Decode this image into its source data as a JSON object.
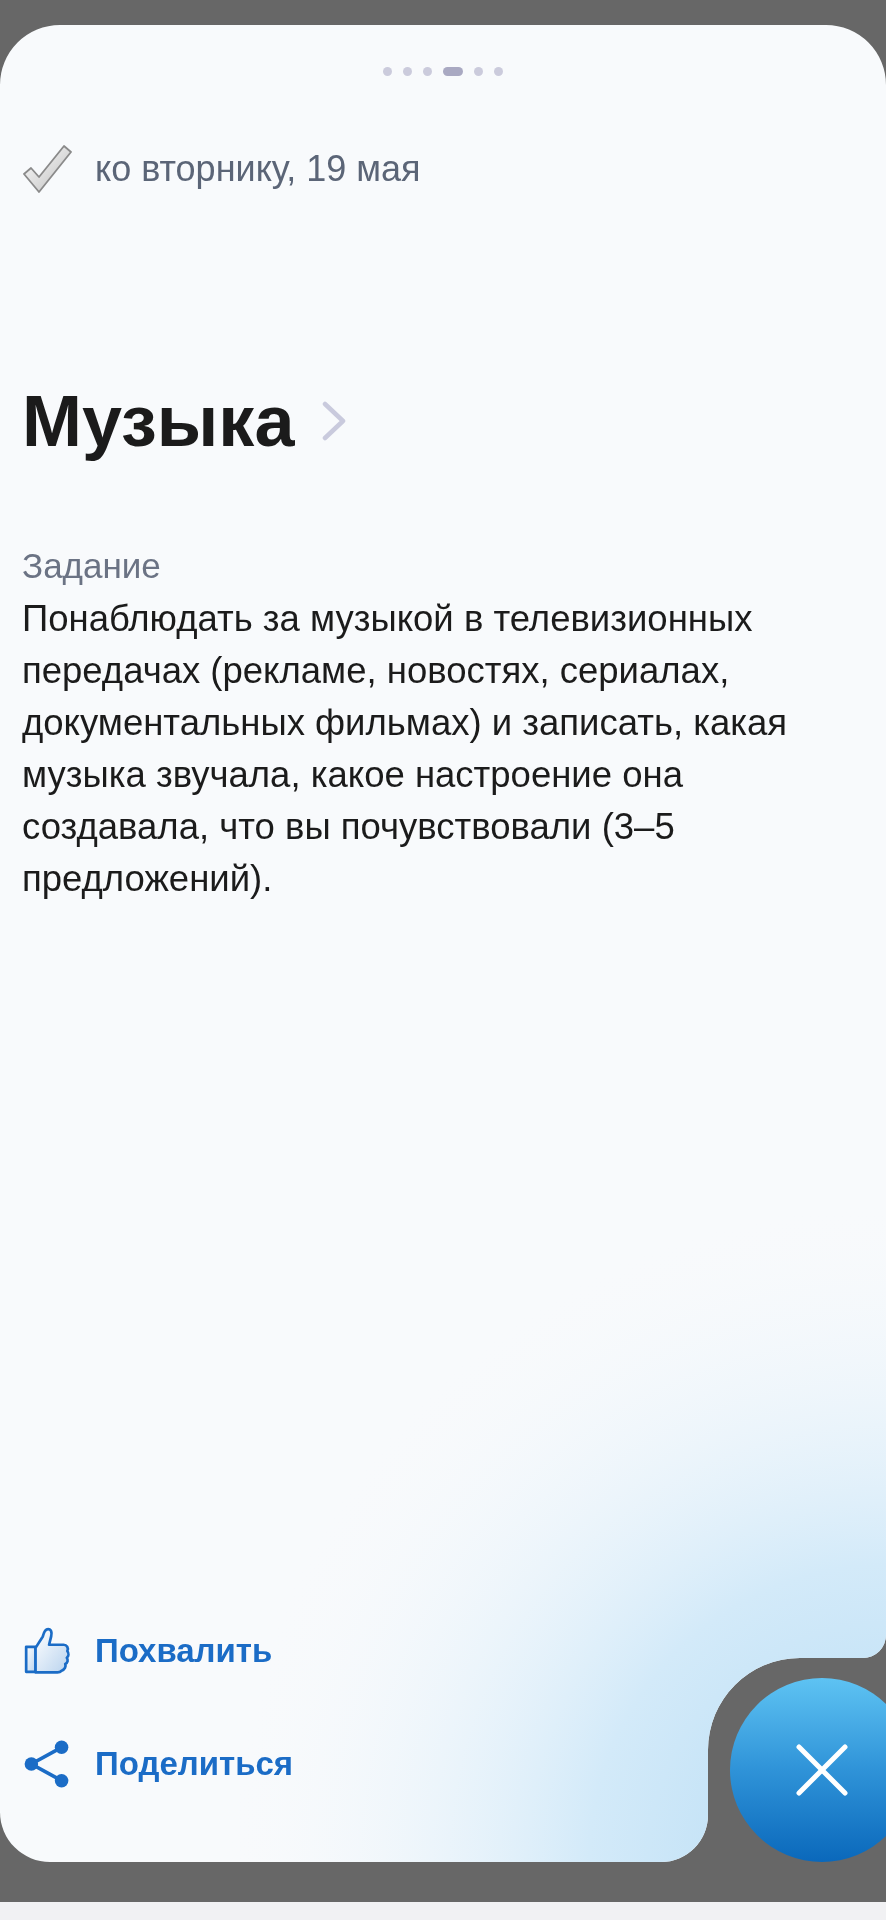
{
  "pager": [
    {
      "selected": false
    },
    {
      "selected": false
    },
    {
      "selected": false
    },
    {
      "selected": true
    },
    {
      "selected": false
    },
    {
      "selected": false
    }
  ],
  "due": {
    "text": "ко вторнику, 19 мая"
  },
  "subject": {
    "title": "Музыка"
  },
  "task": {
    "label": "Задание",
    "text": "Понаблюдать за музыкой в телевизионных передачах (рекламе, новостях, сериалах, документальных фильмах) и записать, какая музыка звучала, какое настроение она создавала, что вы почувствовали (3–5 предложений)."
  },
  "actions": [
    {
      "kind": "like",
      "label": "Похвалить"
    },
    {
      "kind": "share",
      "label": "Поделиться"
    }
  ]
}
